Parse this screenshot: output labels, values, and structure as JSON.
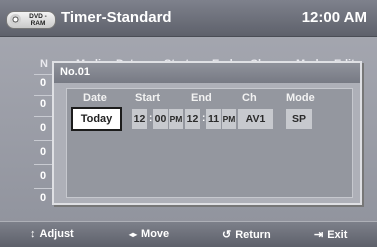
{
  "header": {
    "disc_badge": "DVD -RAM",
    "title": "Timer-Standard",
    "clock": "12:00 AM"
  },
  "background_list": {
    "headers": [
      "N",
      "Media",
      "Date",
      "Start",
      "End",
      "Ch",
      "Mode",
      "Edit"
    ],
    "row_numbers": [
      "0",
      "0",
      "0",
      "0",
      "0",
      "0"
    ]
  },
  "popup": {
    "title": "No.01",
    "columns": {
      "date": "Date",
      "start": "Start",
      "end": "End",
      "ch": "Ch",
      "mode": "Mode"
    },
    "values": {
      "date": "Today",
      "start_hour": "12",
      "start_min": "00",
      "start_ampm": "PM",
      "end_hour": "12",
      "end_min": "11",
      "end_ampm": "PM",
      "channel": "AV1",
      "mode": "SP"
    },
    "time_separator": ":"
  },
  "footer": {
    "adjust": "Adjust",
    "move": "Move",
    "return": "Return",
    "exit": "Exit",
    "adjust_icon": "up-down-arrows",
    "move_icon": "left-right-arrows",
    "return_icon": "return-arrow",
    "exit_icon": "exit-door"
  },
  "colors": {
    "selected_field_bg": "#ffffff",
    "field_bg": "#c7c9ce",
    "bar_bg": "#6b6e78"
  }
}
